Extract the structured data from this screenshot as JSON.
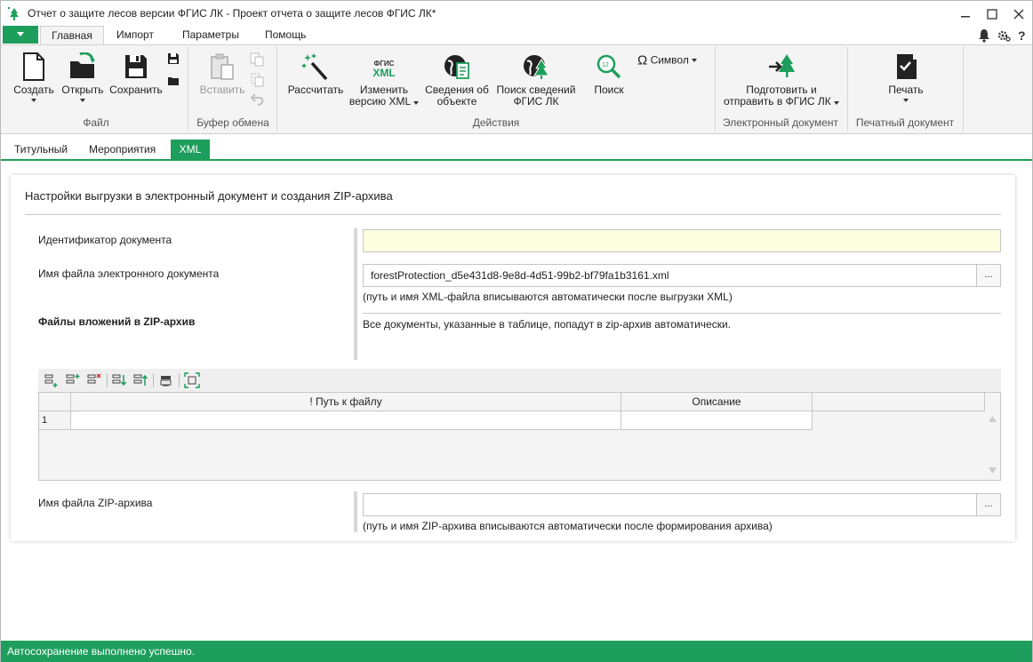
{
  "window": {
    "title": "Отчет о защите лесов версии ФГИС ЛК - Проект отчета о защите лесов ФГИС ЛК*",
    "minimize_icon": "minimize-icon",
    "maximize_icon": "maximize-icon",
    "close_icon": "close-icon"
  },
  "ribbon_tabs": [
    "Главная",
    "Импорт",
    "Параметры",
    "Помощь"
  ],
  "ribbon": {
    "file_group": {
      "label": "Файл",
      "create": "Создать",
      "open": "Открыть",
      "save": "Сохранить"
    },
    "clipboard_group": {
      "label": "Буфер обмена",
      "paste": "Вставить"
    },
    "actions_group": {
      "label": "Действия",
      "calculate": "Рассчитать",
      "change_xml_l1": "Изменить",
      "change_xml_l2": "версию XML",
      "fgis_xml_badge_top": "ФГИС",
      "fgis_xml_badge_bottom": "XML",
      "object_info_l1": "Сведения об",
      "object_info_l2": "объекте",
      "search_fgis_l1": "Поиск сведений",
      "search_fgis_l2": "ФГИС ЛК",
      "search": "Поиск",
      "search_badge": "12",
      "symbol": "Символ"
    },
    "edoc_group": {
      "label": "Электронный документ",
      "prepare_l1": "Подготовить и",
      "prepare_l2": "отправить в ФГИС ЛК"
    },
    "print_group": {
      "label": "Печатный документ",
      "print": "Печать"
    }
  },
  "doc_tabs": [
    "Титульный",
    "Мероприятия",
    "XML"
  ],
  "settings": {
    "title": "Настройки выгрузки в электронный документ и создания ZIP-архива",
    "doc_id_label": "Идентификатор документа",
    "doc_id_value": "",
    "edoc_filename_label": "Имя файла электронного документа",
    "edoc_filename_value": "forestProtection_d5e431d8-9e8d-4d51-99b2-bf79fa1b3161.xml",
    "edoc_hint": "(путь и имя XML-файла вписываются автоматически после выгрузки XML)",
    "attachments_label": "Файлы вложений в ZIP-архив",
    "attachments_note": "Все документы, указанные в таблице, попадут в zip-архив автоматически.",
    "browse_label": "...",
    "zip_label": "Имя файла ZIP-архива",
    "zip_value": "",
    "zip_hint": "(путь и имя ZIP-архива вписываются автоматически после формирования архива)"
  },
  "attachments_table": {
    "columns": [
      "! Путь к файлу",
      "Описание"
    ],
    "rows": [
      {
        "num": "1",
        "path": "",
        "description": ""
      }
    ]
  },
  "status": {
    "text": "Автосохранение выполнено успешно."
  },
  "colors": {
    "accent": "#1e9e5c",
    "required_field": "#fdfde0"
  }
}
